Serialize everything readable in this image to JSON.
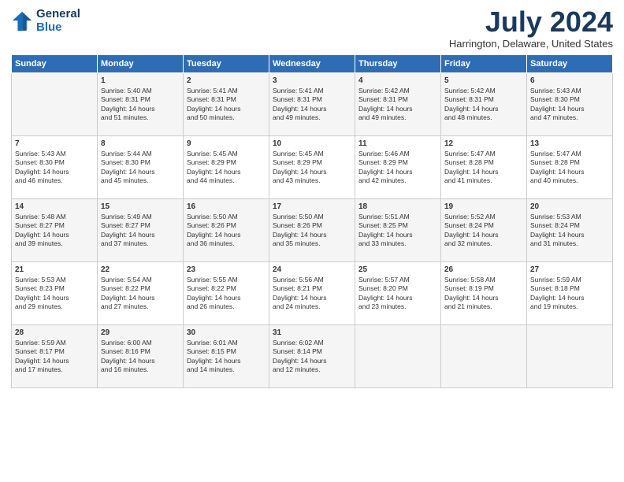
{
  "header": {
    "logo_line1": "General",
    "logo_line2": "Blue",
    "month_title": "July 2024",
    "location": "Harrington, Delaware, United States"
  },
  "days_of_week": [
    "Sunday",
    "Monday",
    "Tuesday",
    "Wednesday",
    "Thursday",
    "Friday",
    "Saturday"
  ],
  "weeks": [
    [
      {
        "day": "",
        "info": ""
      },
      {
        "day": "1",
        "info": "Sunrise: 5:40 AM\nSunset: 8:31 PM\nDaylight: 14 hours\nand 51 minutes."
      },
      {
        "day": "2",
        "info": "Sunrise: 5:41 AM\nSunset: 8:31 PM\nDaylight: 14 hours\nand 50 minutes."
      },
      {
        "day": "3",
        "info": "Sunrise: 5:41 AM\nSunset: 8:31 PM\nDaylight: 14 hours\nand 49 minutes."
      },
      {
        "day": "4",
        "info": "Sunrise: 5:42 AM\nSunset: 8:31 PM\nDaylight: 14 hours\nand 49 minutes."
      },
      {
        "day": "5",
        "info": "Sunrise: 5:42 AM\nSunset: 8:31 PM\nDaylight: 14 hours\nand 48 minutes."
      },
      {
        "day": "6",
        "info": "Sunrise: 5:43 AM\nSunset: 8:30 PM\nDaylight: 14 hours\nand 47 minutes."
      }
    ],
    [
      {
        "day": "7",
        "info": "Sunrise: 5:43 AM\nSunset: 8:30 PM\nDaylight: 14 hours\nand 46 minutes."
      },
      {
        "day": "8",
        "info": "Sunrise: 5:44 AM\nSunset: 8:30 PM\nDaylight: 14 hours\nand 45 minutes."
      },
      {
        "day": "9",
        "info": "Sunrise: 5:45 AM\nSunset: 8:29 PM\nDaylight: 14 hours\nand 44 minutes."
      },
      {
        "day": "10",
        "info": "Sunrise: 5:45 AM\nSunset: 8:29 PM\nDaylight: 14 hours\nand 43 minutes."
      },
      {
        "day": "11",
        "info": "Sunrise: 5:46 AM\nSunset: 8:29 PM\nDaylight: 14 hours\nand 42 minutes."
      },
      {
        "day": "12",
        "info": "Sunrise: 5:47 AM\nSunset: 8:28 PM\nDaylight: 14 hours\nand 41 minutes."
      },
      {
        "day": "13",
        "info": "Sunrise: 5:47 AM\nSunset: 8:28 PM\nDaylight: 14 hours\nand 40 minutes."
      }
    ],
    [
      {
        "day": "14",
        "info": "Sunrise: 5:48 AM\nSunset: 8:27 PM\nDaylight: 14 hours\nand 39 minutes."
      },
      {
        "day": "15",
        "info": "Sunrise: 5:49 AM\nSunset: 8:27 PM\nDaylight: 14 hours\nand 37 minutes."
      },
      {
        "day": "16",
        "info": "Sunrise: 5:50 AM\nSunset: 8:26 PM\nDaylight: 14 hours\nand 36 minutes."
      },
      {
        "day": "17",
        "info": "Sunrise: 5:50 AM\nSunset: 8:26 PM\nDaylight: 14 hours\nand 35 minutes."
      },
      {
        "day": "18",
        "info": "Sunrise: 5:51 AM\nSunset: 8:25 PM\nDaylight: 14 hours\nand 33 minutes."
      },
      {
        "day": "19",
        "info": "Sunrise: 5:52 AM\nSunset: 8:24 PM\nDaylight: 14 hours\nand 32 minutes."
      },
      {
        "day": "20",
        "info": "Sunrise: 5:53 AM\nSunset: 8:24 PM\nDaylight: 14 hours\nand 31 minutes."
      }
    ],
    [
      {
        "day": "21",
        "info": "Sunrise: 5:53 AM\nSunset: 8:23 PM\nDaylight: 14 hours\nand 29 minutes."
      },
      {
        "day": "22",
        "info": "Sunrise: 5:54 AM\nSunset: 8:22 PM\nDaylight: 14 hours\nand 27 minutes."
      },
      {
        "day": "23",
        "info": "Sunrise: 5:55 AM\nSunset: 8:22 PM\nDaylight: 14 hours\nand 26 minutes."
      },
      {
        "day": "24",
        "info": "Sunrise: 5:56 AM\nSunset: 8:21 PM\nDaylight: 14 hours\nand 24 minutes."
      },
      {
        "day": "25",
        "info": "Sunrise: 5:57 AM\nSunset: 8:20 PM\nDaylight: 14 hours\nand 23 minutes."
      },
      {
        "day": "26",
        "info": "Sunrise: 5:58 AM\nSunset: 8:19 PM\nDaylight: 14 hours\nand 21 minutes."
      },
      {
        "day": "27",
        "info": "Sunrise: 5:59 AM\nSunset: 8:18 PM\nDaylight: 14 hours\nand 19 minutes."
      }
    ],
    [
      {
        "day": "28",
        "info": "Sunrise: 5:59 AM\nSunset: 8:17 PM\nDaylight: 14 hours\nand 17 minutes."
      },
      {
        "day": "29",
        "info": "Sunrise: 6:00 AM\nSunset: 8:16 PM\nDaylight: 14 hours\nand 16 minutes."
      },
      {
        "day": "30",
        "info": "Sunrise: 6:01 AM\nSunset: 8:15 PM\nDaylight: 14 hours\nand 14 minutes."
      },
      {
        "day": "31",
        "info": "Sunrise: 6:02 AM\nSunset: 8:14 PM\nDaylight: 14 hours\nand 12 minutes."
      },
      {
        "day": "",
        "info": ""
      },
      {
        "day": "",
        "info": ""
      },
      {
        "day": "",
        "info": ""
      }
    ]
  ]
}
